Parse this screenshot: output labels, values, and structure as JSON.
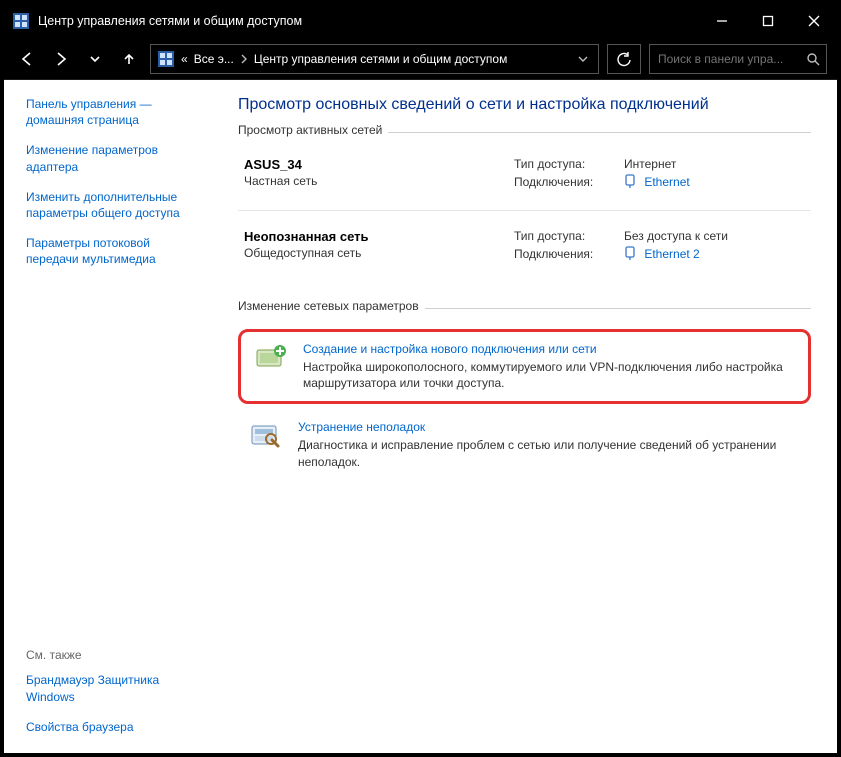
{
  "window": {
    "title": "Центр управления сетями и общим доступом"
  },
  "nav": {
    "crumb1_prefix": "«",
    "crumb1": "Все э...",
    "crumb2": "Центр управления сетями и общим доступом",
    "search_placeholder": "Поиск в панели упра..."
  },
  "sidebar": {
    "links": [
      "Панель управления — домашняя страница",
      "Изменение параметров адаптера",
      "Изменить дополнительные параметры общего доступа",
      "Параметры потоковой передачи мультимедиа"
    ],
    "see_also_label": "См. также",
    "see_also_links": [
      "Брандмауэр Защитника Windows",
      "Свойства браузера"
    ]
  },
  "main": {
    "heading": "Просмотр основных сведений о сети и настройка подключений",
    "active_legend": "Просмотр активных сетей",
    "networks": [
      {
        "name": "ASUS_34",
        "type": "Частная сеть",
        "access_label": "Тип доступа:",
        "access_value": "Интернет",
        "conn_label": "Подключения:",
        "conn_link": "Ethernet"
      },
      {
        "name": "Неопознанная сеть",
        "type": "Общедоступная сеть",
        "access_label": "Тип доступа:",
        "access_value": "Без доступа к сети",
        "conn_label": "Подключения:",
        "conn_link": "Ethernet 2"
      }
    ],
    "change_legend": "Изменение сетевых параметров",
    "tasks": [
      {
        "title": "Создание и настройка нового подключения или сети",
        "desc": "Настройка широкополосного, коммутируемого или VPN-подключения либо настройка маршрутизатора или точки доступа."
      },
      {
        "title": "Устранение неполадок",
        "desc": "Диагностика и исправление проблем с сетью или получение сведений об устранении неполадок."
      }
    ]
  }
}
